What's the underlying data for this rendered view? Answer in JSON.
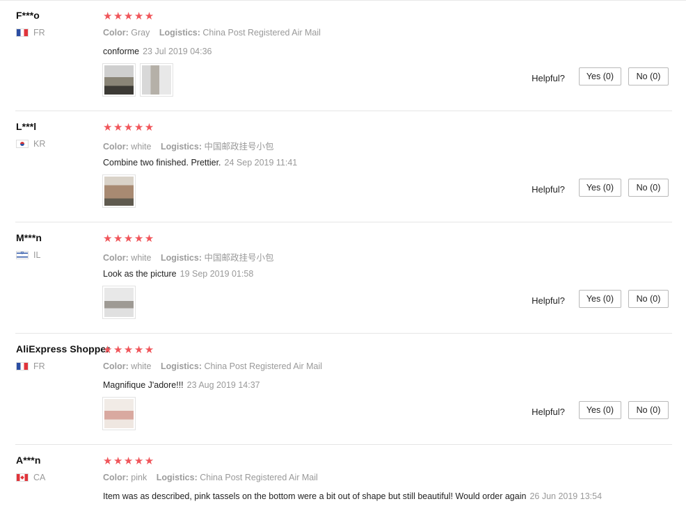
{
  "helpful_label": "Helpful?",
  "color_key": "Color:",
  "logistics_key": "Logistics:",
  "reviews": [
    {
      "user": "F***o",
      "country": "FR",
      "flag": "france-flag",
      "rating": "★★★★★",
      "color": "Gray",
      "logistics": "China Post Registered Air Mail",
      "comment": "conforme",
      "date": "23 Jul 2019 04:36",
      "yes": "Yes (0)",
      "no": "No (0)"
    },
    {
      "user": "L***l",
      "country": "KR",
      "flag": "south-korea-flag",
      "rating": "★★★★★",
      "color": "white",
      "logistics": "中国邮政挂号小包",
      "comment": "Combine two finished. Prettier.",
      "date": "24 Sep 2019 11:41",
      "yes": "Yes (0)",
      "no": "No (0)"
    },
    {
      "user": "M***n",
      "country": "IL",
      "flag": "israel-flag",
      "rating": "★★★★★",
      "color": "white",
      "logistics": "中国邮政挂号小包",
      "comment": "Look as the picture",
      "date": "19 Sep 2019 01:58",
      "yes": "Yes (0)",
      "no": "No (0)"
    },
    {
      "user": "AliExpress Shopper",
      "country": "FR",
      "flag": "france-flag",
      "rating": "★★★★★",
      "color": "white",
      "logistics": "China Post Registered Air Mail",
      "comment": "Magnifique J'adore!!!",
      "date": "23 Aug 2019 14:37",
      "yes": "Yes (0)",
      "no": "No (0)"
    },
    {
      "user": "A***n",
      "country": "CA",
      "flag": "canada-flag",
      "rating": "★★★★★",
      "color": "pink",
      "logistics": "China Post Registered Air Mail",
      "comment": "Item was as described, pink tassels on the bottom were a bit out of shape but still beautiful! Would order again",
      "date": "26 Jun 2019 13:54"
    }
  ],
  "colors": {
    "star": "#f0555a",
    "muted": "#999999",
    "divider": "#e5e5e5"
  }
}
